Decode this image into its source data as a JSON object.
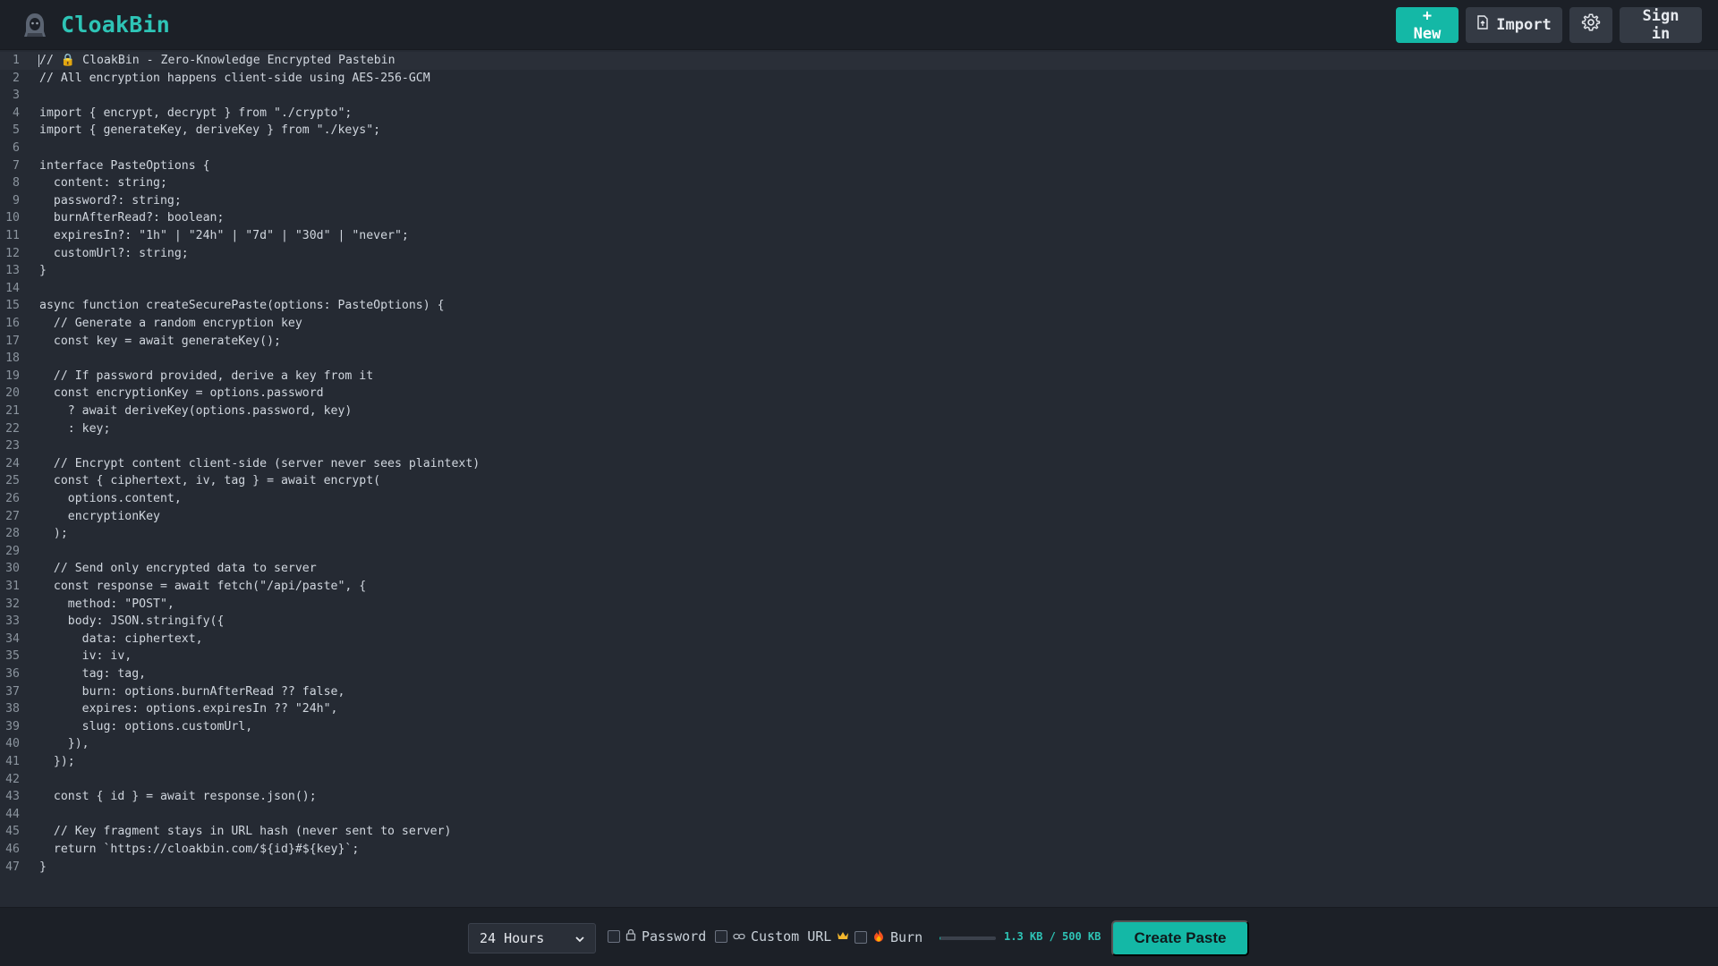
{
  "app": {
    "title": "CloakBin",
    "logo_icon": "hooded-figure-icon",
    "accent": "#14b8a6"
  },
  "header": {
    "new_label": "+ New",
    "import_label": "Import",
    "import_icon": "file-import-icon",
    "settings_icon": "gear-icon",
    "signin_label": "Sign in"
  },
  "editor": {
    "lines": [
      "// 🔒 CloakBin - Zero-Knowledge Encrypted Pastebin",
      "// All encryption happens client-side using AES-256-GCM",
      "",
      "import { encrypt, decrypt } from \"./crypto\";",
      "import { generateKey, deriveKey } from \"./keys\";",
      "",
      "interface PasteOptions {",
      "  content: string;",
      "  password?: string;",
      "  burnAfterRead?: boolean;",
      "  expiresIn?: \"1h\" | \"24h\" | \"7d\" | \"30d\" | \"never\";",
      "  customUrl?: string;",
      "}",
      "",
      "async function createSecurePaste(options: PasteOptions) {",
      "  // Generate a random encryption key",
      "  const key = await generateKey();",
      "",
      "  // If password provided, derive a key from it",
      "  const encryptionKey = options.password",
      "    ? await deriveKey(options.password, key)",
      "    : key;",
      "",
      "  // Encrypt content client-side (server never sees plaintext)",
      "  const { ciphertext, iv, tag } = await encrypt(",
      "    options.content,",
      "    encryptionKey",
      "  );",
      "",
      "  // Send only encrypted data to server",
      "  const response = await fetch(\"/api/paste\", {",
      "    method: \"POST\",",
      "    body: JSON.stringify({",
      "      data: ciphertext,",
      "      iv: iv,",
      "      tag: tag,",
      "      burn: options.burnAfterRead ?? false,",
      "      expires: options.expiresIn ?? \"24h\",",
      "      slug: options.customUrl,",
      "    }),",
      "  });",
      "",
      "  const { id } = await response.json();",
      "",
      "  // Key fragment stays in URL hash (never sent to server)",
      "  return `https://cloakbin.com/${id}#${key}`;",
      "}"
    ]
  },
  "footer": {
    "expiry_selected": "24 Hours",
    "password_label": "Password",
    "password_icon": "lock-icon",
    "custom_url_label": "Custom URL",
    "custom_url_icon": "link-icon",
    "custom_url_badge_icon": "crown-icon",
    "burn_label": "Burn",
    "burn_icon": "fire-icon",
    "size_label": "1.3 KB / 500 KB",
    "size_fraction": 0.0026,
    "create_label": "Create Paste"
  }
}
